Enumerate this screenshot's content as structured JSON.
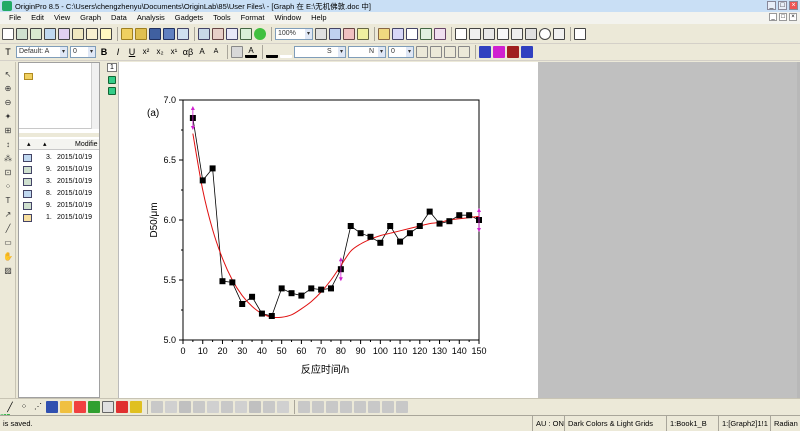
{
  "window": {
    "title": "OriginPro 8.5 - C:\\Users\\chengzhenyu\\Documents\\OriginLab\\85\\User Files\\ - [Graph 在 E:\\无机佛敦.doc 中]"
  },
  "menu": [
    "File",
    "Edit",
    "View",
    "Graph",
    "Data",
    "Analysis",
    "Gadgets",
    "Tools",
    "Format",
    "Window",
    "Help"
  ],
  "toolbar": {
    "zoom": "100%",
    "font_name": "Default: A",
    "font_size": "0",
    "line_style": "S",
    "fill_label": "N",
    "line_width": "0"
  },
  "project_explorer": {
    "headers": [
      "",
      "",
      "Modifie"
    ],
    "rows": [
      {
        "icon": "graph-icon",
        "num": "3.",
        "date": "2015/10/19"
      },
      {
        "icon": "graph-icon",
        "num": "9.",
        "date": "2015/10/19"
      },
      {
        "icon": "graph-icon",
        "num": "3.",
        "date": "2015/10/19"
      },
      {
        "icon": "graph-icon",
        "num": "8.",
        "date": "2015/10/19"
      },
      {
        "icon": "graph-icon",
        "num": "9.",
        "date": "2015/10/19"
      },
      {
        "icon": "notes-icon",
        "num": "1.",
        "date": "2015/10/19"
      }
    ]
  },
  "layer_tab": "1",
  "left_badge": "40",
  "chart_data": {
    "type": "scatter",
    "panel_label": "(a)",
    "xlabel": "反应时间/h",
    "ylabel": "D50/μm",
    "xlim": [
      0,
      150
    ],
    "ylim": [
      5.0,
      7.0
    ],
    "xticks": [
      "0",
      "10",
      "20",
      "30",
      "40",
      "50",
      "60",
      "70",
      "80",
      "90",
      "100",
      "110",
      "120",
      "130",
      "140",
      "150"
    ],
    "yticks": [
      "5.0",
      "5.5",
      "6.0",
      "6.5",
      "7.0"
    ],
    "series": [
      {
        "marker": "square",
        "color": "#000000",
        "x": [
          5,
          10,
          15,
          20,
          25,
          30,
          35,
          40,
          45,
          50,
          55,
          60,
          65,
          70,
          75,
          80,
          85,
          90,
          95,
          100,
          105,
          110,
          115,
          120,
          125,
          130,
          135,
          140,
          145,
          150
        ],
        "y": [
          6.85,
          6.33,
          6.43,
          5.49,
          5.48,
          5.3,
          5.36,
          5.22,
          5.2,
          5.43,
          5.39,
          5.37,
          5.43,
          5.42,
          5.43,
          5.59,
          5.95,
          5.89,
          5.86,
          5.81,
          5.95,
          5.82,
          5.89,
          5.95,
          6.07,
          5.97,
          5.99,
          6.04,
          6.04,
          6.0
        ]
      },
      {
        "type": "line",
        "color": "#e01010",
        "x": [
          5,
          10,
          15,
          20,
          25,
          30,
          35,
          40,
          45,
          50,
          55,
          60,
          65,
          70,
          75,
          80,
          85,
          90,
          95,
          100,
          105,
          110,
          115,
          120,
          125,
          130,
          135,
          140,
          145,
          150
        ],
        "y": [
          6.72,
          6.25,
          5.92,
          5.68,
          5.5,
          5.37,
          5.28,
          5.22,
          5.19,
          5.19,
          5.21,
          5.26,
          5.32,
          5.4,
          5.5,
          5.62,
          5.74,
          5.8,
          5.84,
          5.87,
          5.89,
          5.91,
          5.93,
          5.95,
          5.97,
          5.98,
          6.0,
          6.01,
          6.02,
          6.03
        ]
      },
      {
        "type": "line",
        "color": "#000000",
        "x": [
          5,
          10,
          15,
          20,
          25,
          30,
          35,
          40,
          45,
          50,
          55,
          60,
          65,
          70,
          75,
          80,
          85,
          90,
          95,
          100,
          105,
          110,
          115,
          120,
          125,
          130,
          135,
          140,
          145,
          150
        ],
        "y": [
          6.85,
          6.33,
          6.43,
          5.49,
          5.48,
          5.3,
          5.36,
          5.22,
          5.2,
          5.43,
          5.39,
          5.37,
          5.43,
          5.42,
          5.43,
          5.59,
          5.95,
          5.89,
          5.86,
          5.81,
          5.95,
          5.82,
          5.89,
          5.95,
          6.07,
          5.97,
          5.99,
          6.04,
          6.04,
          6.0
        ]
      }
    ]
  },
  "statusbar": {
    "message": "is saved.",
    "au": "AU : ON",
    "theme": "Dark Colors & Light Grids",
    "book": "1:Book1_B",
    "graph": "1:[Graph2]1!1",
    "unit": "Radian"
  },
  "colors": {
    "accent": "#316ac5",
    "fit_line": "#e01010",
    "handles": "#d020d0"
  }
}
